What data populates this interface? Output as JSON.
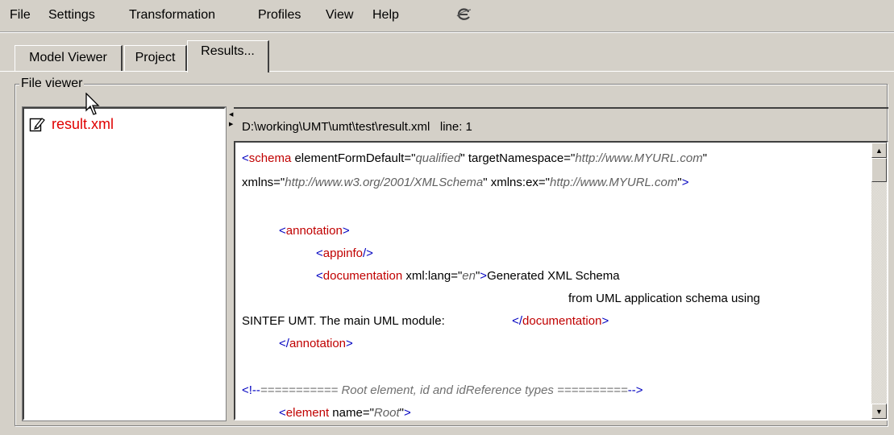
{
  "menu": {
    "items": [
      "File",
      "Settings",
      "Transformation",
      "Profiles",
      "View",
      "Help"
    ],
    "app_icon": "e-logo-icon"
  },
  "tabs": [
    {
      "label": "Model Viewer",
      "active": false
    },
    {
      "label": "Project",
      "active": false
    },
    {
      "label": "Results...",
      "active": true
    }
  ],
  "file_viewer": {
    "title": "File viewer",
    "files": [
      {
        "name": "result.xml",
        "icon": "edit-file-icon",
        "color": "#e00000"
      }
    ],
    "path_label": "D:\\working\\UMT\\umt\\test\\result.xml   line: 1"
  },
  "editor": {
    "lines": [
      {
        "parts": [
          [
            "brk",
            "<"
          ],
          [
            "tag",
            "schema"
          ],
          [
            "txt",
            " elementFormDefault=\""
          ],
          [
            "val",
            "qualified"
          ],
          [
            "txt",
            "\" targetNamespace=\""
          ],
          [
            "val",
            "http://www.MYURL.com"
          ],
          [
            "txt",
            "\""
          ]
        ]
      },
      {
        "parts": [
          [
            "txt",
            "xmlns=\""
          ],
          [
            "val",
            "http://www.w3.org/2001/XMLSchema"
          ],
          [
            "txt",
            "\" xmlns:ex=\""
          ],
          [
            "val",
            "http://www.MYURL.com"
          ],
          [
            "txt",
            "\""
          ],
          [
            "brk",
            ">"
          ]
        ]
      },
      {
        "parts": []
      },
      {
        "parts": [
          [
            "brk",
            "<"
          ],
          [
            "tag",
            "annotation"
          ],
          [
            "brk",
            ">"
          ]
        ],
        "indent": 1
      },
      {
        "parts": [
          [
            "brk",
            "<"
          ],
          [
            "tag",
            "appinfo"
          ],
          [
            "brk",
            "/>"
          ]
        ],
        "indent": 2
      },
      {
        "parts": [
          [
            "brk",
            "<"
          ],
          [
            "tag",
            "documentation"
          ],
          [
            "txt",
            " xml:lang=\""
          ],
          [
            "val",
            "en"
          ],
          [
            "txt",
            "\""
          ],
          [
            "brk",
            ">"
          ],
          [
            "txt",
            "Generated XML Schema"
          ]
        ],
        "indent": 2
      },
      {
        "parts": [
          [
            "txt",
            "from UML application schema using"
          ]
        ],
        "indent": 9
      },
      {
        "parts": [
          [
            "txt",
            "SINTEF UMT. The main UML module:"
          ],
          [
            "txt",
            "                    "
          ],
          [
            "brk",
            "</"
          ],
          [
            "tag",
            "documentation"
          ],
          [
            "brk",
            ">"
          ]
        ]
      },
      {
        "parts": [
          [
            "brk",
            "</"
          ],
          [
            "tag",
            "annotation"
          ],
          [
            "brk",
            ">"
          ]
        ],
        "indent": 1
      },
      {
        "parts": []
      },
      {
        "parts": [
          [
            "brk",
            "<!--"
          ],
          [
            "cmt",
            "=========== Root element, id and idReference types =========="
          ],
          [
            "brk",
            "-->"
          ]
        ]
      },
      {
        "parts": [
          [
            "brk",
            "<"
          ],
          [
            "tag",
            "element"
          ],
          [
            "txt",
            " name=\""
          ],
          [
            "val",
            "Root"
          ],
          [
            "txt",
            "\""
          ],
          [
            "brk",
            ">"
          ]
        ],
        "indent": 1
      }
    ]
  },
  "scrollbar": {
    "up_icon": "scroll-up-arrow-icon",
    "down_icon": "scroll-down-arrow-icon"
  }
}
